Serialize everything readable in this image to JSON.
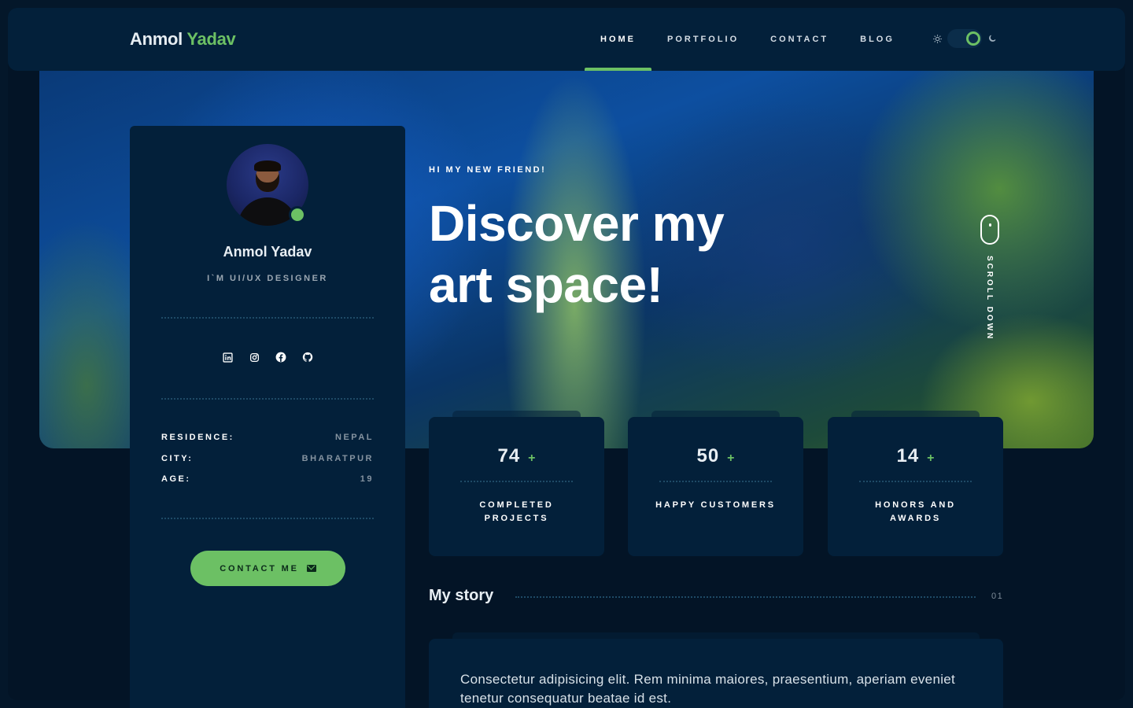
{
  "brand": {
    "first": "Anmol",
    "last": "Yadav"
  },
  "nav": {
    "items": [
      {
        "label": "HOME",
        "active": true
      },
      {
        "label": "PORTFOLIO",
        "active": false
      },
      {
        "label": "CONTACT",
        "active": false
      },
      {
        "label": "BLOG",
        "active": false
      }
    ],
    "theme": {
      "light_icon": "sun-icon",
      "dark_icon": "moon-icon",
      "mode": "dark"
    }
  },
  "hero": {
    "greeting": "HI MY NEW FRIEND!",
    "title": "Discover my art space!",
    "scroll_label": "SCROLL DOWN"
  },
  "profile": {
    "name": "Anmol Yadav",
    "role": "I`M UI/UX DESIGNER",
    "status": "online",
    "socials": [
      "linkedin-icon",
      "instagram-icon",
      "facebook-icon",
      "github-icon"
    ],
    "info": [
      {
        "key": "RESIDENCE:",
        "value": "NEPAL"
      },
      {
        "key": "CITY:",
        "value": "BHARATPUR"
      },
      {
        "key": "AGE:",
        "value": "19"
      }
    ],
    "contact_label": "CONTACT ME"
  },
  "stats": [
    {
      "value": "74",
      "suffix": "+",
      "label": "COMPLETED PROJECTS"
    },
    {
      "value": "50",
      "suffix": "+",
      "label": "HAPPY CUSTOMERS"
    },
    {
      "value": "14",
      "suffix": "+",
      "label": "HONORS AND AWARDS"
    }
  ],
  "story": {
    "heading": "My story",
    "number": "01",
    "text": "Consectetur adipisicing elit. Rem minima maiores, praesentium, aperiam eveniet tenetur consequatur beatae id est."
  },
  "colors": {
    "accent": "#6cc064",
    "panel": "#03203a",
    "background": "#04172a"
  }
}
